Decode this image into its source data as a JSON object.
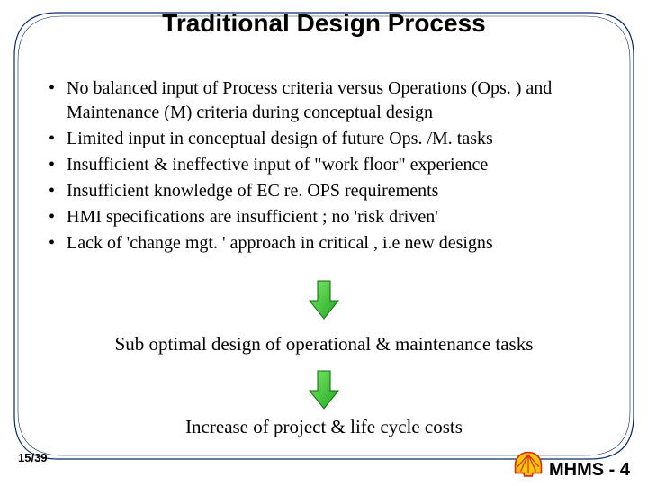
{
  "title": "Traditional Design Process",
  "bullets": [
    "No balanced input of Process criteria versus Operations (Ops. ) and Maintenance (M) criteria during conceptual design",
    "Limited input in conceptual design of future Ops. /M. tasks",
    "Insufficient & ineffective input of \"work floor\" experience",
    "Insufficient knowledge of EC re. OPS requirements",
    "HMI specifications are insufficient ; no 'risk driven'",
    "Lack of 'change mgt. ' approach in critical , i.e new designs"
  ],
  "sub1": "Sub optimal design of operational & maintenance tasks",
  "sub2": "Increase of project & life cycle costs",
  "page_number": "15/39",
  "footer_label": "MHMS - 4"
}
